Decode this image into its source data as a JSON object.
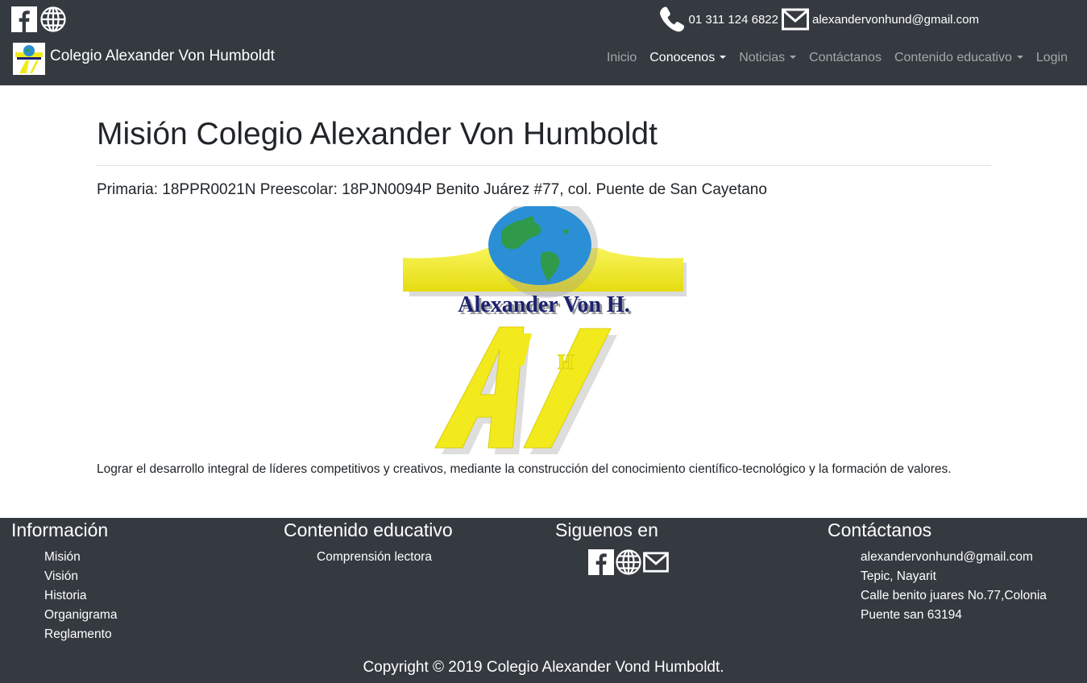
{
  "header": {
    "phone": "01 311 124 6822",
    "email": "alexandervonhund@gmail.com",
    "brand": "Colegio Alexander Von Humboldt",
    "icons": [
      "facebook-icon",
      "globe-icon",
      "phone-icon",
      "mail-icon"
    ],
    "nav": [
      {
        "label": "Inicio",
        "active": false,
        "dropdown": false
      },
      {
        "label": "Conocenos",
        "active": true,
        "dropdown": true
      },
      {
        "label": "Noticias",
        "active": false,
        "dropdown": true
      },
      {
        "label": "Contáctanos",
        "active": false,
        "dropdown": false
      },
      {
        "label": "Contenido educativo",
        "active": false,
        "dropdown": true
      },
      {
        "label": "Login",
        "active": false,
        "dropdown": false
      }
    ]
  },
  "main": {
    "title": "Misión Colegio Alexander Von Humboldt",
    "codes": "Primaria: 18PPR0021N Preescolar: 18PJN0094P Benito Juárez #77, col. Puente de San Cayetano",
    "logo_text": "Alexander Von H.",
    "mission": "Lograr el desarrollo integral de líderes competitivos y creativos, mediante la construcción del conocimiento científico-tecnológico y la formación de valores."
  },
  "footer": {
    "info": {
      "title": "Información",
      "links": [
        "Misión",
        "Visión",
        "Historia",
        "Organigrama",
        "Reglamento"
      ]
    },
    "edu": {
      "title": "Contenido educativo",
      "links": [
        "Comprensión lectora"
      ]
    },
    "social": {
      "title": "Siguenos en"
    },
    "contact": {
      "title": "Contáctanos",
      "lines": [
        "alexandervonhund@gmail.com",
        "Tepic, Nayarit",
        "Calle benito juares No.77,Colonia",
        "Puente san 63194"
      ]
    },
    "copyright": "Copyright © 2019 Colegio Alexander Vond Humboldt."
  },
  "colors": {
    "dark": "#343a40",
    "logo_yellow": "#f2ea1c",
    "logo_blue": "#1c2270",
    "globe_blue": "#2b8fd6",
    "globe_green": "#2f9a4a"
  }
}
